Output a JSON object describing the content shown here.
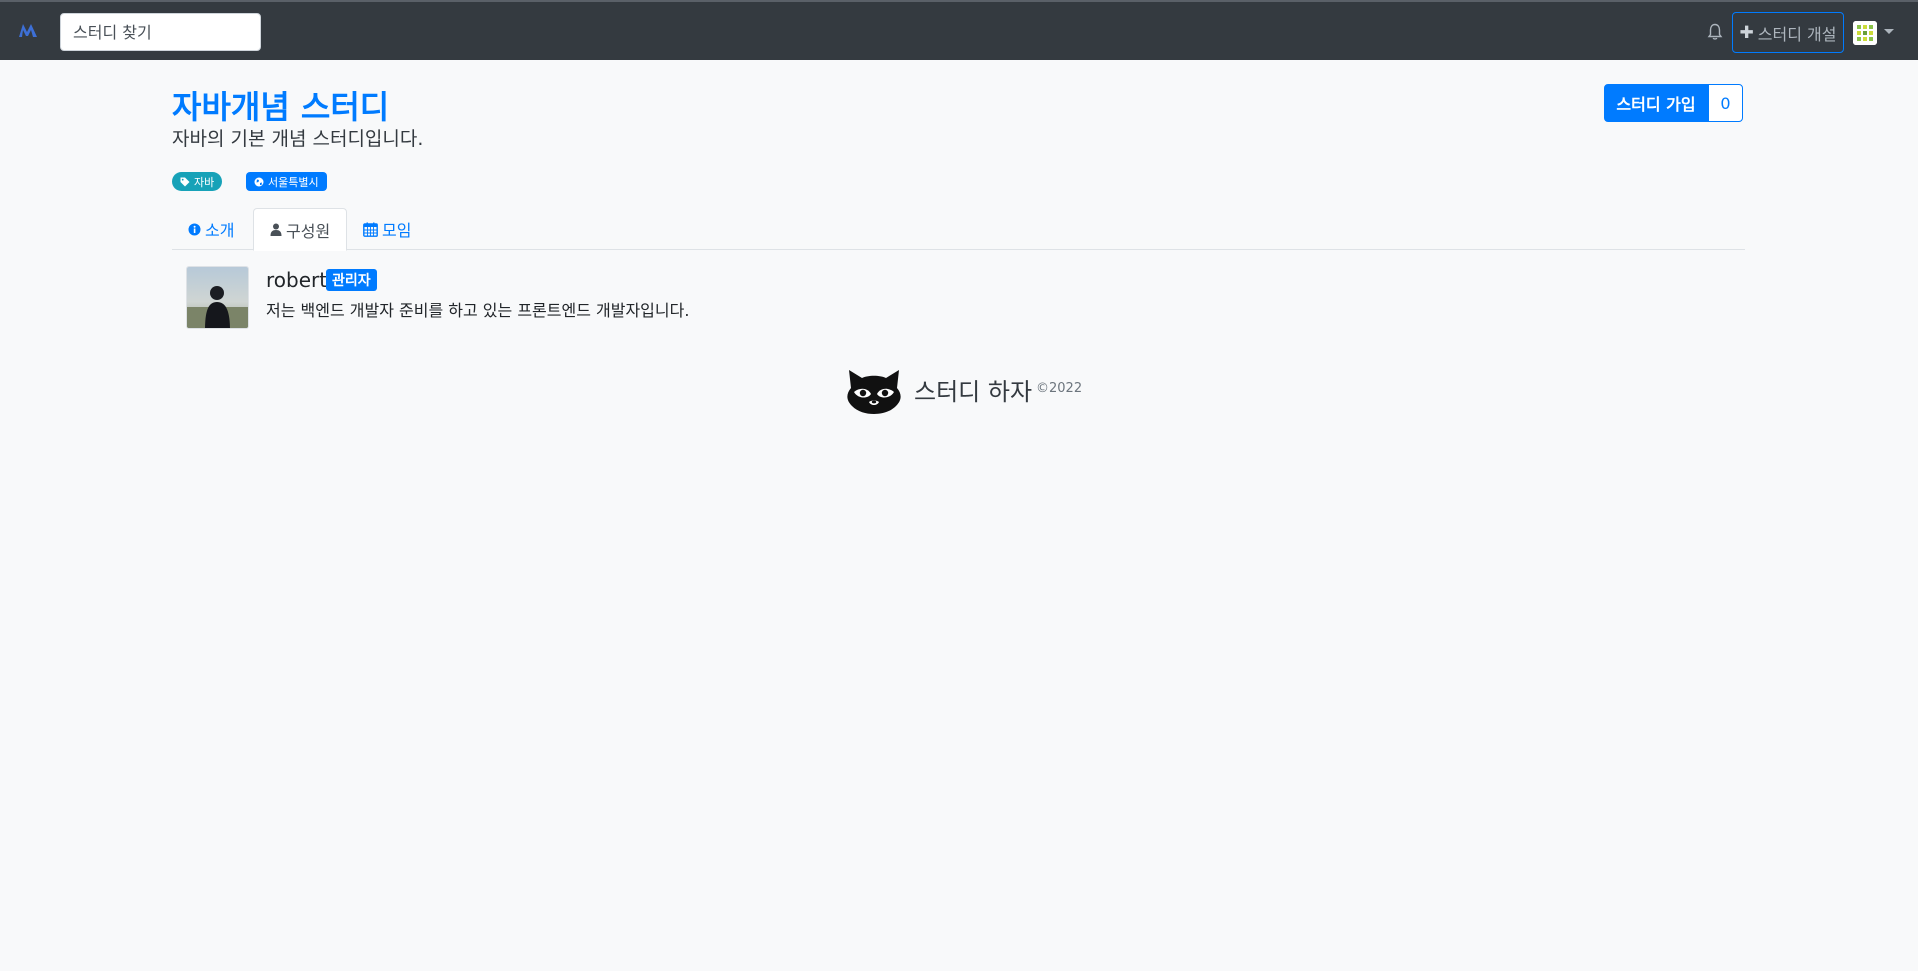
{
  "navbar": {
    "search": {
      "placeholder": "스터디 찾기"
    },
    "open_study_label": "스터디 개설",
    "icons": [
      "logo-icon",
      "bell-icon",
      "plus-icon",
      "avatar-icon",
      "caret-down-icon"
    ]
  },
  "study": {
    "title": "자바개념 스터디",
    "description": "자바의 기본 개념 스터디입니다.",
    "join_label": "스터디 가입",
    "member_count": "0",
    "tags": [
      {
        "label": "자바",
        "icon": "tag-icon"
      },
      {
        "label": "서울특별시",
        "icon": "globe-icon"
      }
    ]
  },
  "tabs": [
    {
      "label": "소개",
      "icon": "info-icon",
      "active": false
    },
    {
      "label": "구성원",
      "icon": "user-icon",
      "active": true
    },
    {
      "label": "모임",
      "icon": "calendar-icon",
      "active": false
    }
  ],
  "members": [
    {
      "name": "robert",
      "badge": "관리자",
      "bio": "저는 백엔드 개발자 준비를 하고 있는 프론트엔드 개발자입니다."
    }
  ],
  "footer": {
    "brand": "스터디 하자",
    "copyright": "©2022"
  },
  "colors": {
    "navbar": "#343a40",
    "primary": "#007bff",
    "info": "#17a2b8",
    "background": "#f8f9fa"
  }
}
